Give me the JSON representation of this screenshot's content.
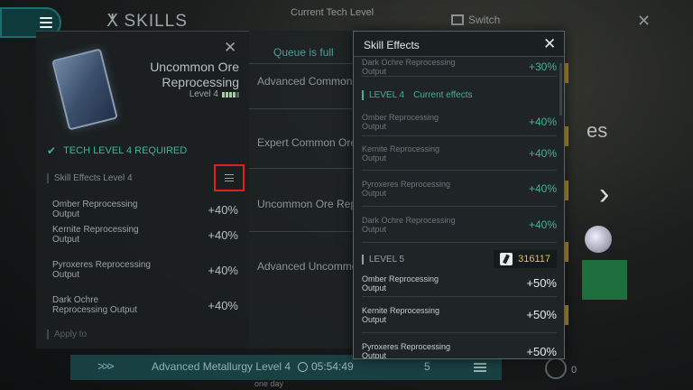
{
  "top": {
    "title": "SKILLS",
    "center_text": "Current Tech Level",
    "switch_label": "Switch"
  },
  "skill": {
    "name": "Uncommon Ore Reprocessing",
    "level_label": "Level 4",
    "requirement": "TECH LEVEL 4 REQUIRED",
    "effects_header": "Skill Effects Level 4",
    "effects": [
      {
        "name": "Omber Reprocessing Output",
        "value": "+40%"
      },
      {
        "name": "Kernite Reprocessing Output",
        "value": "+40%"
      },
      {
        "name": "Pyroxeres Reprocessing Output",
        "value": "+40%"
      },
      {
        "name": "Dark Ochre Reprocessing Output",
        "value": "+40%"
      }
    ],
    "footer_section": "Apply to"
  },
  "queue": {
    "status": "Queue is full",
    "items": [
      "Advanced Common",
      "Expert Common Ore",
      "Uncommon Ore Rep",
      "Advanced Uncommo"
    ]
  },
  "right_partial": {
    "text": "es"
  },
  "bottom": {
    "arrows": ">>>",
    "task": "Advanced Metallurgy Level 4",
    "time": "05:54:49",
    "count": "5",
    "sub": "one day",
    "zero": "0"
  },
  "modal": {
    "title": "Skill Effects",
    "prev_row": {
      "name": "Dark Ochre Reprocessing Output",
      "value": "+30%"
    },
    "level4": {
      "label": "LEVEL 4",
      "current": "Current effects"
    },
    "level4_rows": [
      {
        "name": "Omber Reprocessing Output",
        "value": "+40%"
      },
      {
        "name": "Kernite Reprocessing Output",
        "value": "+40%"
      },
      {
        "name": "Pyroxeres Reprocessing Output",
        "value": "+40%"
      },
      {
        "name": "Dark Ochre Reprocessing Output",
        "value": "+40%"
      }
    ],
    "level5": {
      "label": "LEVEL 5",
      "sp_cost": "316117"
    },
    "level5_rows": [
      {
        "name": "Omber Reprocessing Output",
        "value": "+50%"
      },
      {
        "name": "Kernite Reprocessing Output",
        "value": "+50%"
      },
      {
        "name": "Pyroxeres Reprocessing Output",
        "value": "+50%"
      }
    ]
  },
  "colors": {
    "accent": "#3fb39a",
    "highlight_box": "#e02020",
    "sp_value": "#e8c04a"
  }
}
